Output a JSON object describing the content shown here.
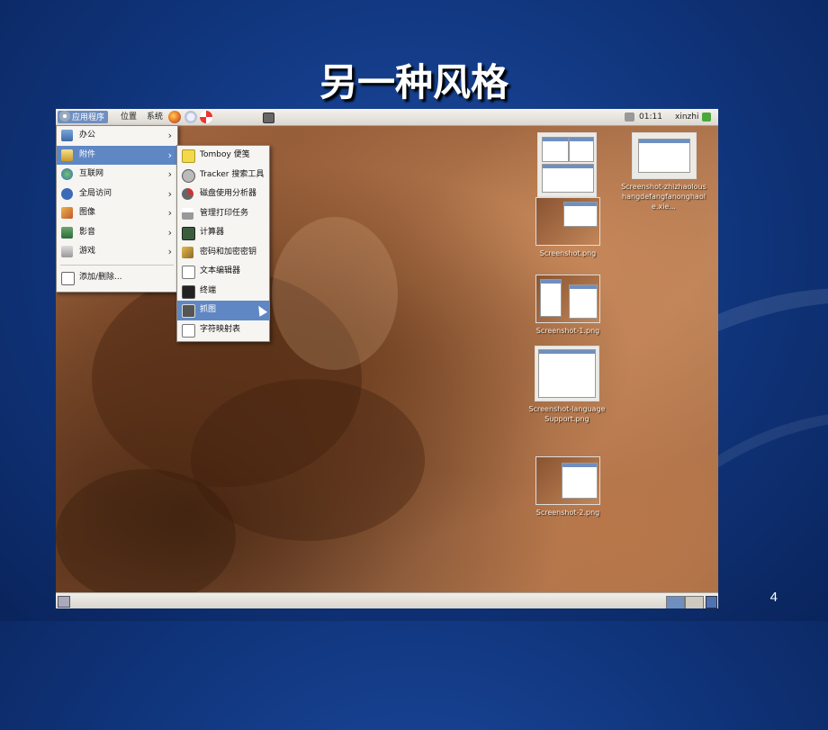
{
  "slide": {
    "title": "另一种风格",
    "page_number": "4"
  },
  "top_panel": {
    "menus": [
      "应用程序",
      "位置",
      "系统"
    ],
    "clock": "01:11",
    "user": "xinzhi"
  },
  "apps_menu": {
    "items": [
      {
        "label": "办公",
        "icon": "office-icon"
      },
      {
        "label": "附件",
        "icon": "accessories-icon"
      },
      {
        "label": "互联网",
        "icon": "internet-icon"
      },
      {
        "label": "全局访问",
        "icon": "accessibility-icon"
      },
      {
        "label": "图像",
        "icon": "graphics-icon"
      },
      {
        "label": "影音",
        "icon": "multimedia-icon"
      },
      {
        "label": "游戏",
        "icon": "games-icon"
      }
    ],
    "add_remove": "添加/删除..."
  },
  "accessories_menu": {
    "items": [
      {
        "label": "Tomboy 便笺",
        "icon": "notes-icon"
      },
      {
        "label": "Tracker 搜索工具",
        "icon": "search-tool-icon"
      },
      {
        "label": "磁盘使用分析器",
        "icon": "disk-analyzer-icon"
      },
      {
        "label": "管理打印任务",
        "icon": "printer-icon"
      },
      {
        "label": "计算器",
        "icon": "calculator-icon"
      },
      {
        "label": "密码和加密密钥",
        "icon": "keys-icon"
      },
      {
        "label": "文本编辑器",
        "icon": "text-editor-icon"
      },
      {
        "label": "终端",
        "icon": "terminal-icon"
      },
      {
        "label": "抓图",
        "icon": "screenshot-icon"
      },
      {
        "label": "字符映射表",
        "icon": "charmap-icon"
      }
    ]
  },
  "desktop": {
    "files": [
      {
        "label": "Screenshot-zhizhaoloushangdefangfanonghaole.xie..."
      },
      {
        "label": "Screenshot.png"
      },
      {
        "label": "Screenshot-1.png"
      },
      {
        "label": "Screenshot-language Support.png"
      },
      {
        "label": "Screenshot-2.png"
      }
    ]
  },
  "colors": {
    "slide_bg": "#10357c",
    "menu_highlight": "#5f87c4",
    "panel": "#e8e5de"
  }
}
